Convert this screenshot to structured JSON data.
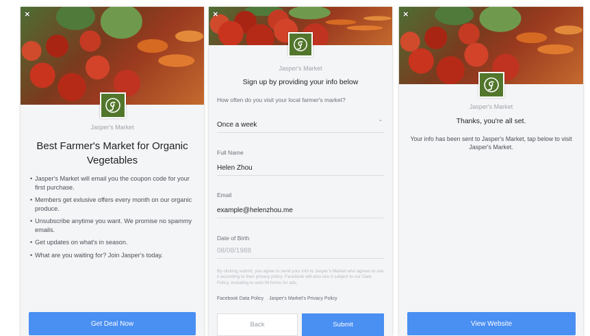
{
  "brand_colors": {
    "accent": "#4a8ff2",
    "logo_green": "#52762c"
  },
  "card1": {
    "brand": "Jasper's Market",
    "headline": "Best Farmer's Market for Organic Vegetables",
    "bullets": [
      "Jasper's Market will email you the coupon code for your first purchase.",
      "Members get exlusive offers every month on our organic produce.",
      "Unsubscribe anytime you want. We promise no spammy emails.",
      "Get updates on what's in season.",
      "What are you waiting for? Join Jasper's today."
    ],
    "cta": "Get Deal Now"
  },
  "card2": {
    "brand": "Jasper's Market",
    "subtitle": "Sign up by providing your info below",
    "question_label": "How often do you visit your local farmer's market?",
    "question_value": "Once a week",
    "name_label": "Full Name",
    "name_value": "Helen Zhou",
    "email_label": "Email",
    "email_value": "example@helenzhou.me",
    "dob_label": "Date of Birth",
    "dob_placeholder": "08/08/1988",
    "disclaimer": "By clicking submit, you agree to send your info to Jasper's Market who agrees to use it according to their privacy policy. Facebook will also use it subject to our Data Policy, including to auto-fill forms for ads.",
    "link_fb": "Facebook Data Policy",
    "link_privacy": "Jasper's Market's Privacy Policy",
    "back": "Back",
    "submit": "Submit"
  },
  "card3": {
    "brand": "Jasper's Market",
    "title": "Thanks, you're all set.",
    "body": "Your info has been sent to Jasper's Market, tap below to visit Jasper's Market.",
    "cta": "View Website"
  },
  "close_glyph": "×",
  "logo_glyph": "g",
  "chevron_glyph": "⌄",
  "icons": [
    "close-icon",
    "jaspers-market-logo",
    "chevron-down-icon"
  ]
}
